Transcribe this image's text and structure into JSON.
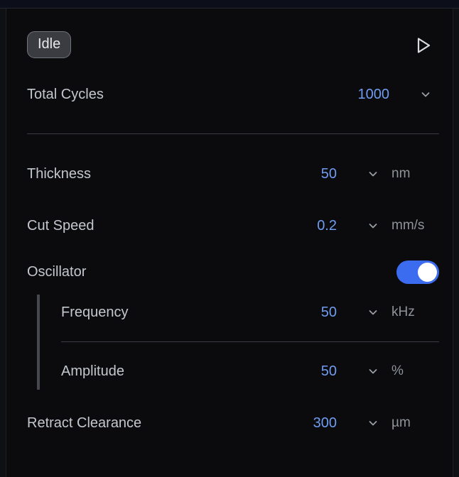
{
  "status": {
    "label": "Idle"
  },
  "total_cycles": {
    "label": "Total Cycles",
    "value": "1000"
  },
  "thickness": {
    "label": "Thickness",
    "value": "50",
    "unit": "nm"
  },
  "cut_speed": {
    "label": "Cut Speed",
    "value": "0.2",
    "unit": "mm/s"
  },
  "oscillator": {
    "label": "Oscillator",
    "enabled": true,
    "frequency": {
      "label": "Frequency",
      "value": "50",
      "unit": "kHz"
    },
    "amplitude": {
      "label": "Amplitude",
      "value": "50",
      "unit": "%"
    }
  },
  "retract_clearance": {
    "label": "Retract Clearance",
    "value": "300",
    "unit": "µm"
  },
  "colors": {
    "accent": "#3b6cf0",
    "value_text": "#6f9cf2",
    "background": "#0b0b0d"
  },
  "icons": {
    "play": "play-icon",
    "chevron": "chevron-down-icon"
  }
}
